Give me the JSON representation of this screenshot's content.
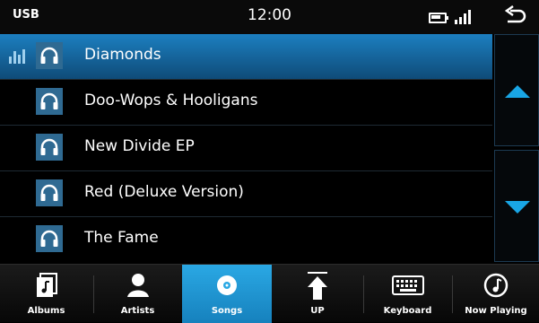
{
  "status": {
    "source": "USB",
    "time": "12:00"
  },
  "songs": [
    {
      "title": "Diamonds",
      "selected": true
    },
    {
      "title": "Doo-Wops & Hooligans",
      "selected": false
    },
    {
      "title": "New Divide EP",
      "selected": false
    },
    {
      "title": "Red (Deluxe Version)",
      "selected": false
    },
    {
      "title": "The Fame",
      "selected": false
    }
  ],
  "tabs": [
    {
      "label": "Albums",
      "icon": "album-icon"
    },
    {
      "label": "Artists",
      "icon": "person-icon"
    },
    {
      "label": "Songs",
      "icon": "disc-icon",
      "active": true
    },
    {
      "label": "UP",
      "icon": "up-arrow-icon"
    },
    {
      "label": "Keyboard",
      "icon": "keyboard-icon"
    },
    {
      "label": "Now Playing",
      "icon": "music-note-icon"
    }
  ],
  "colors": {
    "accent": "#1c7fc0",
    "active_tab": "#2aa8e4",
    "arrow": "#19a6e6",
    "icon_box": "#2f6a92"
  }
}
